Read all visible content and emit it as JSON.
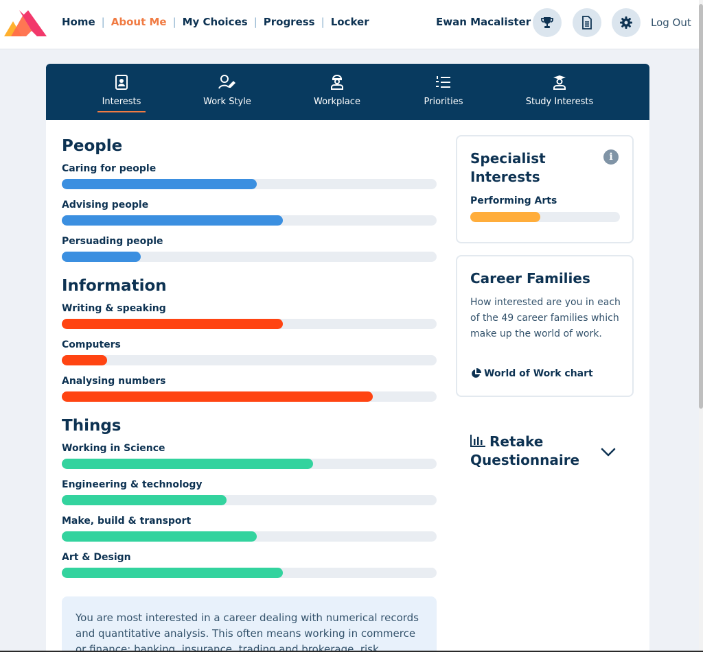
{
  "header": {
    "nav": [
      {
        "label": "Home",
        "active": false
      },
      {
        "label": "About Me",
        "active": true
      },
      {
        "label": "My Choices",
        "active": false
      },
      {
        "label": "Progress",
        "active": false
      },
      {
        "label": "Locker",
        "active": false
      }
    ],
    "user_name": "Ewan Macalister",
    "logout_label": "Log Out",
    "icons": [
      "trophy-icon",
      "document-icon",
      "gear-icon"
    ]
  },
  "tabs": [
    {
      "label": "Interests",
      "icon": "profile-card-icon",
      "active": true
    },
    {
      "label": "Work Style",
      "icon": "user-style-icon",
      "active": false
    },
    {
      "label": "Workplace",
      "icon": "worker-icon",
      "active": false
    },
    {
      "label": "Priorities",
      "icon": "numbered-list-icon",
      "active": false
    },
    {
      "label": "Study Interests",
      "icon": "graduate-icon",
      "active": false
    }
  ],
  "sections": [
    {
      "title": "People",
      "color": "#3b8fe0",
      "items": [
        {
          "label": "Caring for people",
          "value": 0.52
        },
        {
          "label": "Advising people",
          "value": 0.59
        },
        {
          "label": "Persuading people",
          "value": 0.21
        }
      ]
    },
    {
      "title": "Information",
      "color": "#ff4412",
      "items": [
        {
          "label": "Writing & speaking",
          "value": 0.59
        },
        {
          "label": "Computers",
          "value": 0.12
        },
        {
          "label": "Analysing numbers",
          "value": 0.83
        }
      ]
    },
    {
      "title": "Things",
      "color": "#33d39e",
      "items": [
        {
          "label": "Working in Science",
          "value": 0.67
        },
        {
          "label": "Engineering & technology",
          "value": 0.44
        },
        {
          "label": "Make, build & transport",
          "value": 0.52
        },
        {
          "label": "Art & Design",
          "value": 0.59
        }
      ]
    }
  ],
  "summary_text": "You are most interested in a career dealing with numerical records and quantitative analysis. This often means working in commerce or finance: banking, insurance, trading and brokerage, risk analysis",
  "specialist": {
    "title": "Specialist Interests",
    "item_label": "Performing Arts",
    "item_value": 0.47,
    "color": "#ffad3b"
  },
  "career_families": {
    "title": "Career Families",
    "text": "How interested are you in each of the 49 career families which make up the world of work.",
    "link_label": "World of Work chart"
  },
  "retake": {
    "title": "Retake Questionnaire"
  }
}
